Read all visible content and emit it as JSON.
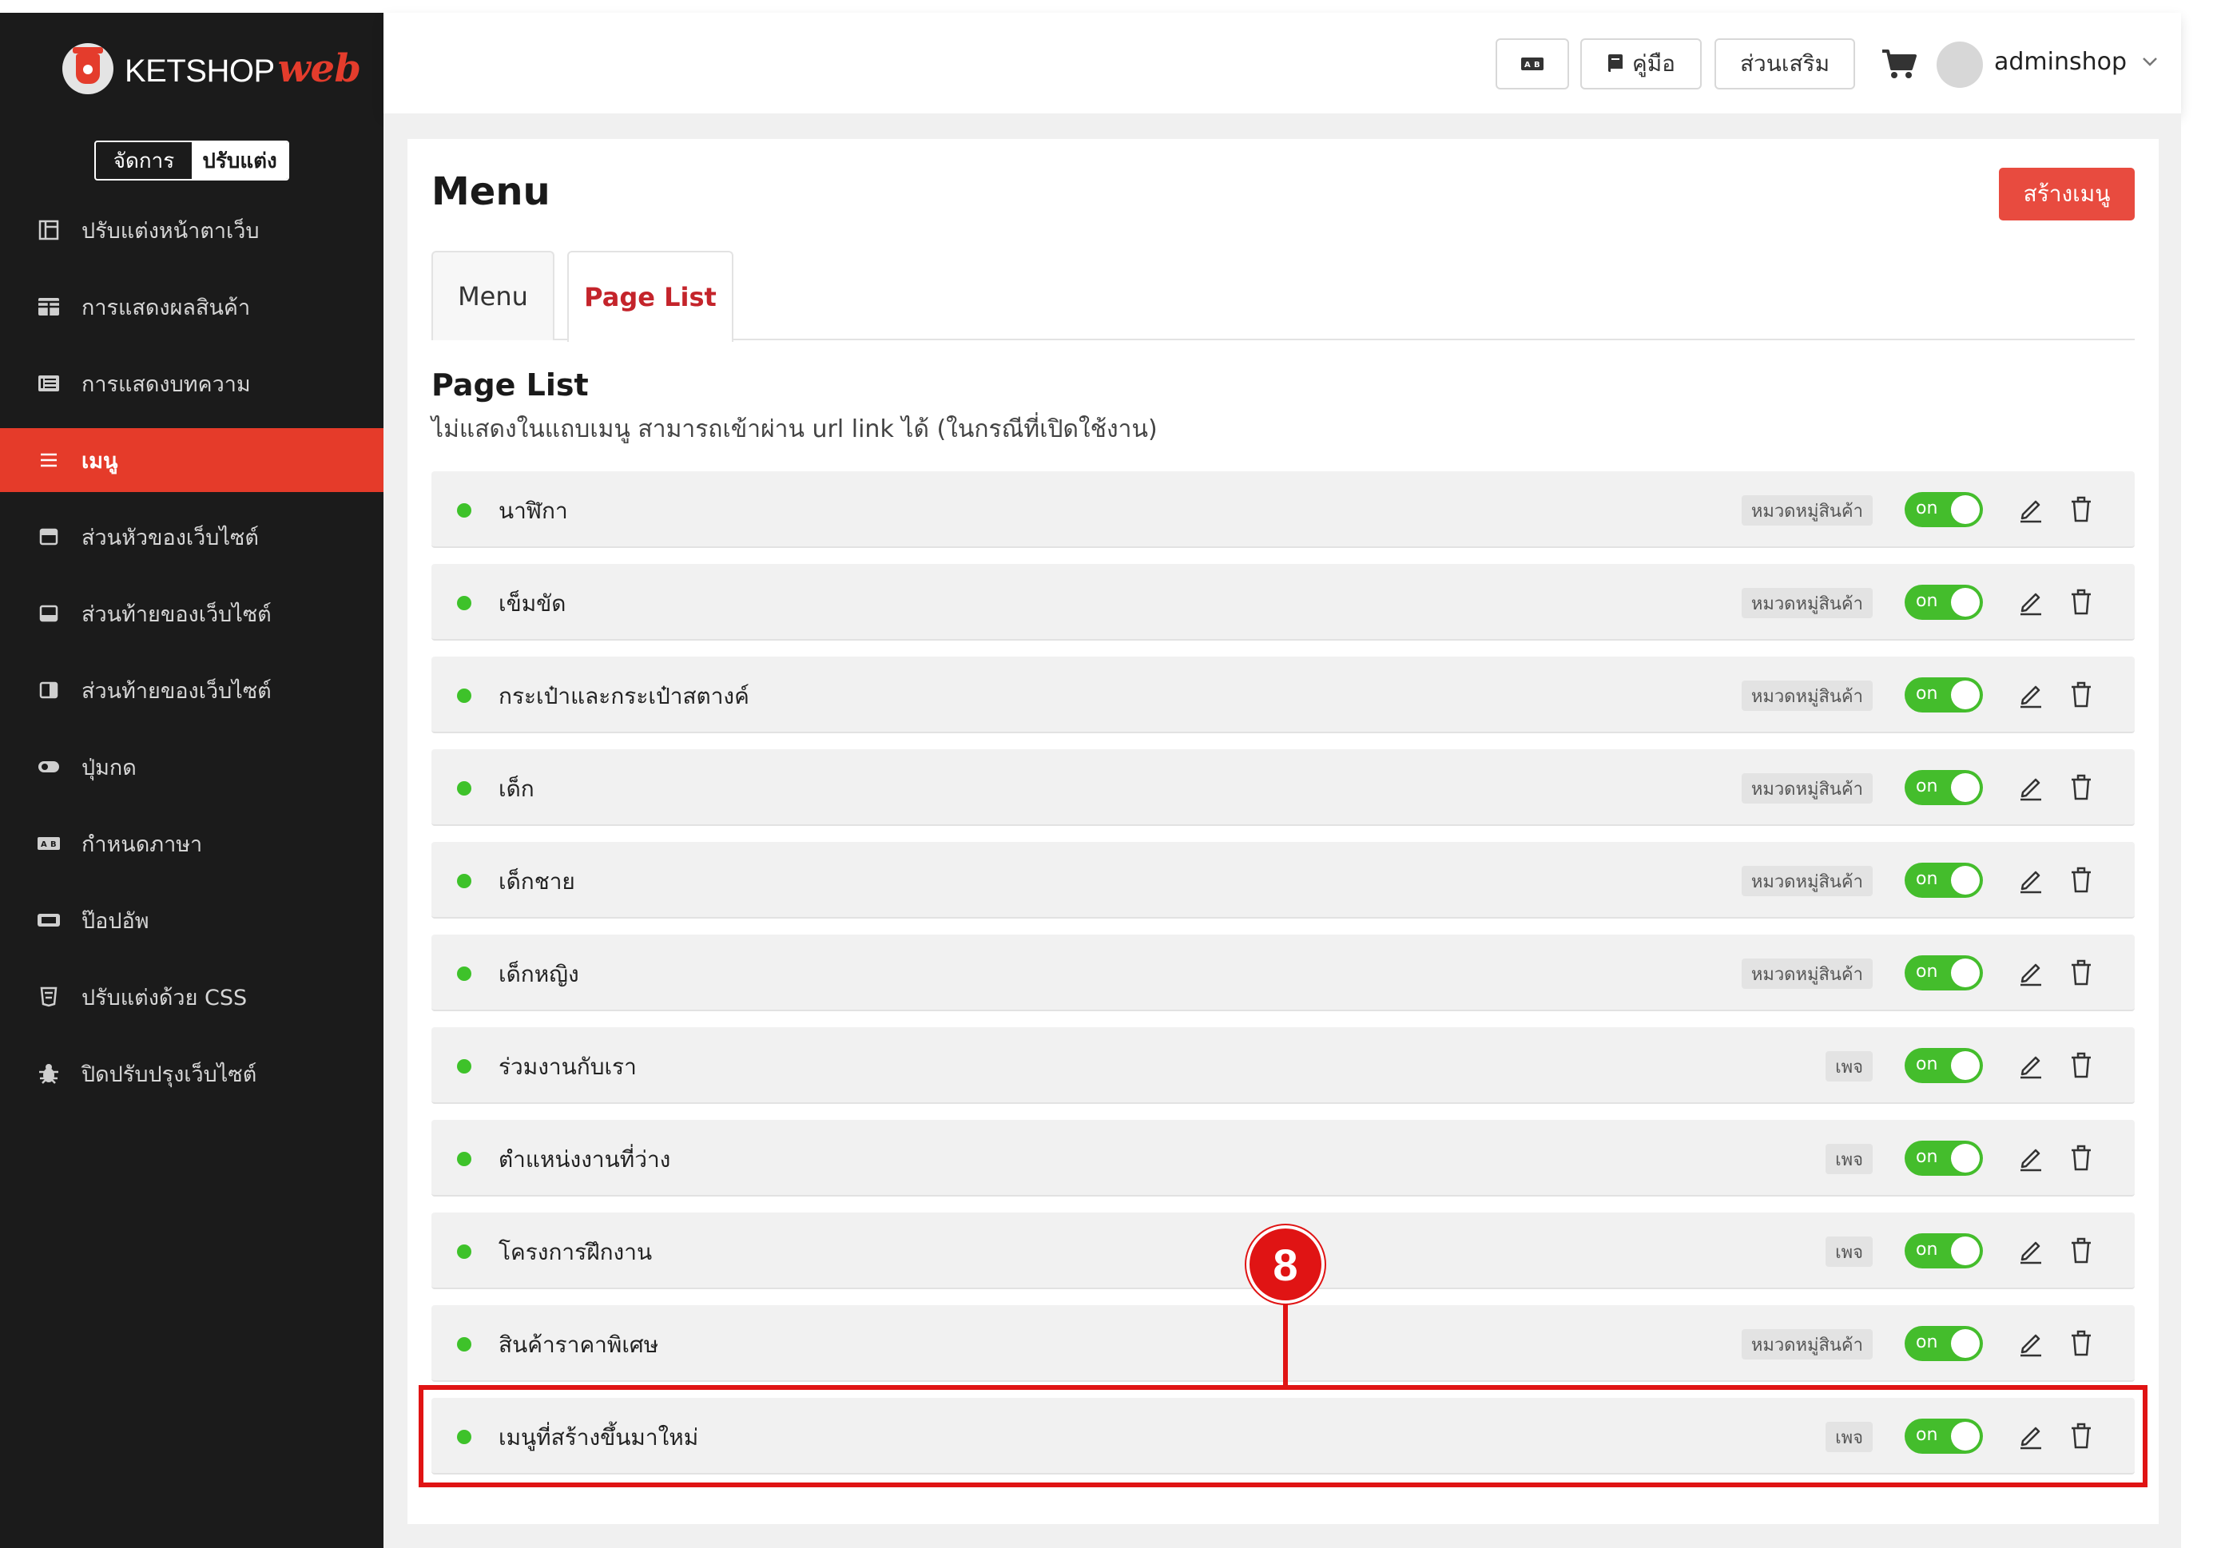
{
  "brand": {
    "name": "KETSHOP",
    "accent": "web",
    "accent_color": "#e43c2c"
  },
  "mode_toggle": {
    "manage": "จัดการ",
    "customize": "ปรับแต่ง"
  },
  "sidebar": {
    "items": [
      {
        "label": "ปรับแต่งหน้าตาเว็บ",
        "icon": "layout-icon"
      },
      {
        "label": "การแสดงผลสินค้า",
        "icon": "grid-icon"
      },
      {
        "label": "การแสดงบทความ",
        "icon": "article-icon"
      },
      {
        "label": "เมนู",
        "icon": "menu-icon",
        "active": true
      },
      {
        "label": "ส่วนหัวของเว็บไซต์",
        "icon": "header-icon"
      },
      {
        "label": "ส่วนท้ายของเว็บไซต์",
        "icon": "footer-icon"
      },
      {
        "label": "ส่วนท้ายของเว็บไซต์",
        "icon": "sidebar-panel-icon"
      },
      {
        "label": "ปุ่มกด",
        "icon": "toggle-button-icon"
      },
      {
        "label": "กำหนดภาษา",
        "icon": "language-icon"
      },
      {
        "label": "ป๊อปอัพ",
        "icon": "popup-icon"
      },
      {
        "label": "ปรับแต่งด้วย CSS",
        "icon": "css-icon"
      },
      {
        "label": "ปิดปรับปรุงเว็บไซต์",
        "icon": "bug-icon"
      }
    ]
  },
  "header": {
    "manual_label": "คู่มือ",
    "addon_label": "ส่วนเสริม",
    "username": "adminshop"
  },
  "main": {
    "title": "Menu",
    "create_button": "สร้างเมนู",
    "tabs": [
      {
        "label": "Menu",
        "active": false
      },
      {
        "label": "Page List",
        "active": true
      }
    ],
    "section_title": "Page List",
    "section_desc": "ไม่แสดงในแถบเมนู สามารถเข้าผ่าน url link ได้ (ในกรณีที่เปิดใช้งาน)",
    "toggle_label": "on",
    "rows": [
      {
        "name": "นาฬิกา",
        "tag": "หมวดหมู่สินค้า"
      },
      {
        "name": "เข็มขัด",
        "tag": "หมวดหมู่สินค้า"
      },
      {
        "name": "กระเป๋าและกระเป๋าสตางค์",
        "tag": "หมวดหมู่สินค้า"
      },
      {
        "name": "เด็ก",
        "tag": "หมวดหมู่สินค้า"
      },
      {
        "name": "เด็กชาย",
        "tag": "หมวดหมู่สินค้า"
      },
      {
        "name": "เด็กหญิง",
        "tag": "หมวดหมู่สินค้า"
      },
      {
        "name": "ร่วมงานกับเรา",
        "tag": "เพจ"
      },
      {
        "name": "ตำแหน่งงานที่ว่าง",
        "tag": "เพจ"
      },
      {
        "name": "โครงการฝึกงาน",
        "tag": "เพจ"
      },
      {
        "name": "สินค้าราคาพิเศษ",
        "tag": "หมวดหมู่สินค้า"
      },
      {
        "name": "เมนูที่สร้างขึ้นมาใหม่",
        "tag": "เพจ"
      }
    ]
  },
  "annotation": {
    "step": "8",
    "color": "#e01414"
  },
  "colors": {
    "active_nav": "#e53b2a",
    "toggle_on": "#44bd2c",
    "status_dot": "#3ec22a",
    "create_button": "#e84b3f",
    "active_tab_text": "#c4242b"
  }
}
